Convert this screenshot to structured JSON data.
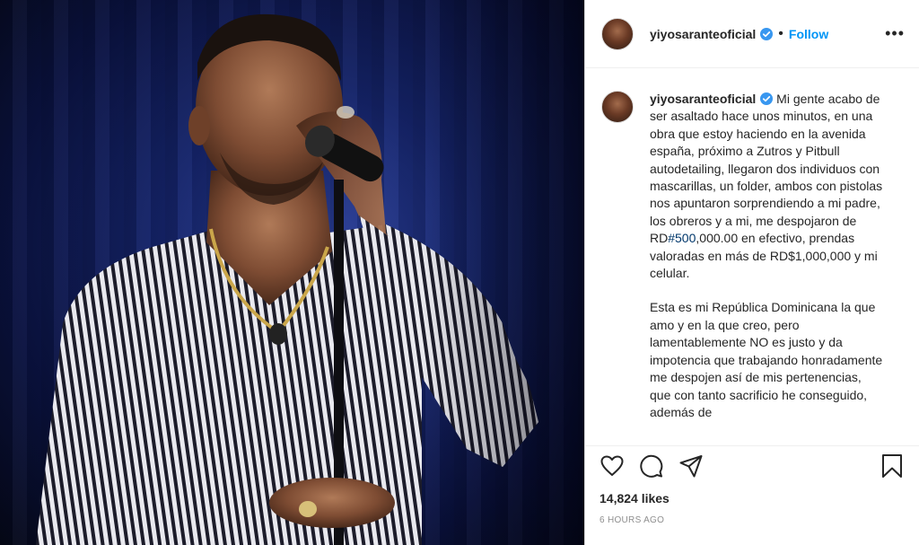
{
  "post": {
    "username": "yiyosaranteoficial",
    "follow_label": "Follow",
    "more_label": "•••",
    "caption_paragraph_1_before": "Mi gente acabo de ser asaltado hace unos minutos, en una obra que estoy haciendo en la avenida españa, próximo a Zutros y Pitbull autodetailing, llegaron dos individuos con mascarillas, un folder, ambos con pistolas nos apuntaron sorprendiendo a mi padre, los obreros y a mi, me despojaron de RD",
    "caption_hashtag": "#500",
    "caption_paragraph_1_after": ",000.00 en efectivo, prendas valoradas en más de RD$1,000,000 y mi celular.",
    "caption_paragraph_2": "Esta es mi República Dominicana la que amo y en la que creo, pero lamentablemente NO es justo y da impotencia que trabajando honradamente me despojen así de mis pertenencias, que con tanto sacrificio he conseguido, además de",
    "likes": "14,824 likes",
    "timestamp": "6 HOURS AGO"
  },
  "icons": {
    "verified": "verified-badge-icon",
    "like": "heart-icon",
    "comment": "comment-icon",
    "share": "paper-plane-icon",
    "save": "bookmark-icon"
  },
  "colors": {
    "follow": "#0095f6",
    "hashtag": "#00376b",
    "verified": "#3897f0",
    "muted": "#8e8e8e"
  }
}
